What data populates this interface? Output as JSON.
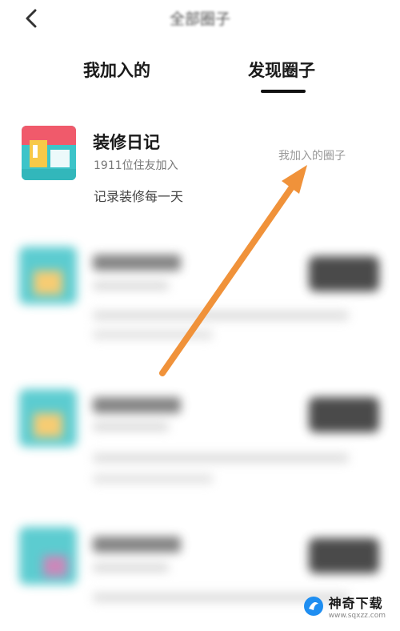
{
  "header": {
    "title": "全部圈子",
    "back_icon": "chevron-left-icon"
  },
  "tabs": [
    {
      "label": "我加入的",
      "active": false
    },
    {
      "label": "发现圈子",
      "active": true
    }
  ],
  "circles": [
    {
      "name": "装修日记",
      "members": "1911位住友加入",
      "description": "记录装修每一天",
      "status": "我加入的圈子"
    }
  ],
  "annotation": {
    "color": "#f0923a"
  },
  "watermark": {
    "name": "神奇下载",
    "url": "www.sqxzz.com"
  }
}
